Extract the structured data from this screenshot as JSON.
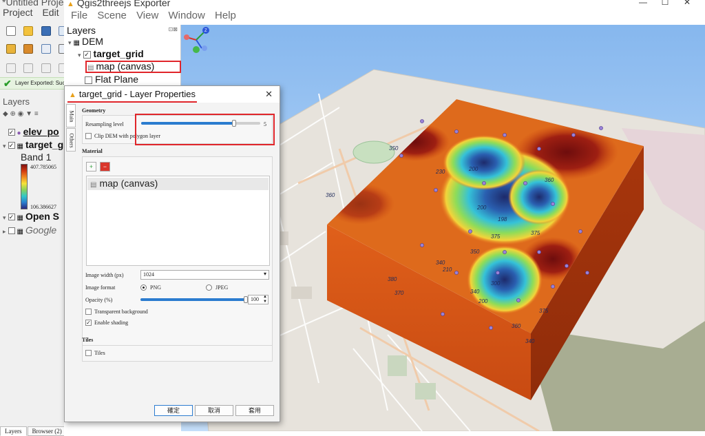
{
  "qgis": {
    "title": "*Untitled Project — QGIS",
    "menu": [
      "Project",
      "Edit"
    ],
    "message": "Layer Exported: Success",
    "panel_title": "Layers",
    "layers": [
      {
        "label": "elev_po",
        "checked": true
      },
      {
        "label": "target_grid",
        "checked": true
      },
      {
        "label": "Open S",
        "checked": true
      },
      {
        "label": "Google",
        "checked": false
      }
    ],
    "band_label": "Band 1",
    "ramp_max": "407.785065",
    "ramp_min": "106.386627",
    "bottom_tabs": [
      "Layers",
      "Browser (2)"
    ]
  },
  "q3": {
    "title": "Qgis2threejs Exporter",
    "menu": [
      "File",
      "Scene",
      "View",
      "Window",
      "Help"
    ],
    "window_controls": [
      "—",
      "☐",
      "✕"
    ],
    "dock_title": "Layers",
    "dock_controls": "⊡⊠",
    "layers": {
      "dem": "DEM",
      "target_grid": "target_grid",
      "map_canvas": "map (canvas)",
      "flat_plane": "Flat Plane"
    },
    "contour_labels": [
      "350",
      "360",
      "230",
      "200",
      "200",
      "198",
      "375",
      "375",
      "350",
      "340",
      "210",
      "300",
      "340",
      "200",
      "375",
      "360",
      "370",
      "380",
      "360",
      "340"
    ]
  },
  "dialog": {
    "title": "target_grid - Layer Properties",
    "close": "✕",
    "tabs": [
      "Main",
      "Others"
    ],
    "geometry": {
      "title": "Geometry",
      "resampling_label": "Resampling level",
      "resampling_value": "5",
      "resampling_fraction": 0.78,
      "clip_label": "Clip DEM with polygon layer",
      "clip_checked": false
    },
    "material": {
      "title": "Material",
      "add_icon": "add-material-icon",
      "remove_icon": "remove-material-icon",
      "list_item": "map (canvas)",
      "image_width_label": "Image width (px)",
      "image_width_value": "1024",
      "image_format_label": "Image format",
      "format_png": "PNG",
      "format_jpeg": "JPEG",
      "format_selected": "PNG",
      "opacity_label": "Opacity (%)",
      "opacity_value": "100",
      "transparent_label": "Transparent background",
      "transparent_checked": false,
      "shading_label": "Enable shading",
      "shading_checked": true
    },
    "tiles": {
      "title": "Tiles",
      "tiles_label": "Tiles",
      "tiles_checked": false
    },
    "buttons": {
      "ok": "確定",
      "cancel": "取消",
      "apply": "套用"
    }
  },
  "colors": {
    "accent": "#2b7ccf",
    "highlight_red": "#e0252a",
    "success_green": "#2a9d2a"
  }
}
